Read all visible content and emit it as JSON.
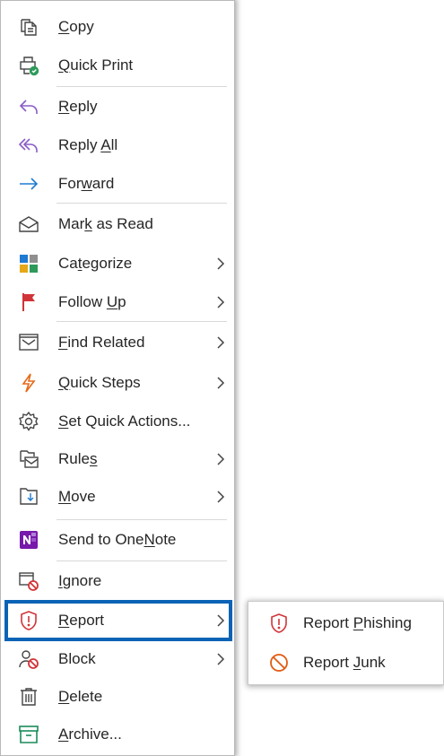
{
  "menu": {
    "items": [
      {
        "pre": "",
        "acc": "C",
        "post": "opy",
        "icon": "copy-icon"
      },
      {
        "pre": "",
        "acc": "Q",
        "post": "uick Print",
        "icon": "quick-print-icon"
      },
      {
        "pre": "",
        "acc": "R",
        "post": "eply",
        "icon": "reply-icon"
      },
      {
        "pre": "Reply ",
        "acc": "A",
        "post": "ll",
        "icon": "reply-all-icon"
      },
      {
        "pre": "For",
        "acc": "w",
        "post": "ard",
        "icon": "forward-icon"
      },
      {
        "pre": "Mar",
        "acc": "k",
        "post": " as Read",
        "icon": "mark-as-read-icon"
      },
      {
        "pre": "Ca",
        "acc": "t",
        "post": "egorize",
        "icon": "categorize-icon",
        "submenu": true
      },
      {
        "pre": "Follow ",
        "acc": "U",
        "post": "p",
        "icon": "flag-icon",
        "submenu": true
      },
      {
        "pre": "",
        "acc": "F",
        "post": "ind Related",
        "icon": "find-related-icon",
        "submenu": true
      },
      {
        "pre": "",
        "acc": "Q",
        "post": "uick Steps",
        "icon": "lightning-icon",
        "submenu": true
      },
      {
        "pre": "",
        "acc": "S",
        "post": "et Quick Actions...",
        "icon": "settings-gear-icon"
      },
      {
        "pre": "Rule",
        "acc": "s",
        "post": "",
        "icon": "rules-icon",
        "submenu": true
      },
      {
        "pre": "",
        "acc": "M",
        "post": "ove",
        "icon": "move-icon",
        "submenu": true
      },
      {
        "pre": "Send to One",
        "acc": "N",
        "post": "ote",
        "icon": "onenote-icon"
      },
      {
        "pre": "",
        "acc": "I",
        "post": "gnore",
        "icon": "ignore-icon"
      },
      {
        "pre": "",
        "acc": "R",
        "post": "eport",
        "icon": "report-shield-icon",
        "submenu": true
      },
      {
        "pre": "",
        "acc": "",
        "post": "Block",
        "icon": "block-user-icon",
        "submenu": true
      },
      {
        "pre": "",
        "acc": "D",
        "post": "elete",
        "icon": "trash-icon"
      },
      {
        "pre": "",
        "acc": "A",
        "post": "rchive...",
        "icon": "archive-icon"
      }
    ]
  },
  "submenu": {
    "items": [
      {
        "pre": "Report ",
        "acc": "P",
        "post": "hishing",
        "icon": "report-shield-icon"
      },
      {
        "pre": "Report ",
        "acc": "J",
        "post": "unk",
        "icon": "junk-prohibited-icon"
      }
    ]
  },
  "colors": {
    "highlight_border": "#0a63b5",
    "reply_purple": "#8a5cc6",
    "forward_blue": "#1f7ad1",
    "flag_red": "#d13438",
    "lightning_orange": "#e66a18",
    "onenote_purple": "#7719aa",
    "archive_green": "#1b8a5a",
    "junk_orange": "#e05b12"
  }
}
